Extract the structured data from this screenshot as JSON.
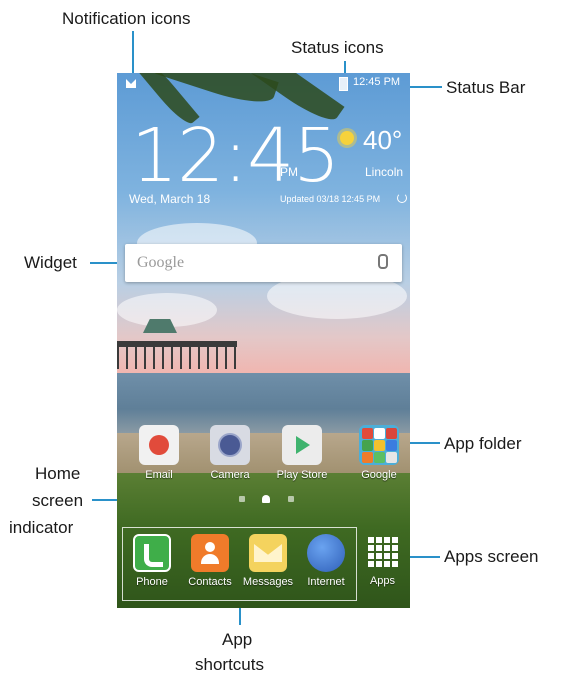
{
  "callouts": {
    "notification_icons": "Notification icons",
    "status_icons": "Status icons",
    "status_bar": "Status Bar",
    "widget": "Widget",
    "app_folder": "App folder",
    "home_indicator": [
      "Home",
      "screen",
      "indicator"
    ],
    "apps_screen": "Apps screen",
    "app_shortcuts": [
      "App",
      "shortcuts"
    ]
  },
  "status_bar": {
    "time": "12:45 PM"
  },
  "widget": {
    "time": "12:45",
    "ampm": "PM",
    "date": "Wed, March 18",
    "temperature": "40°",
    "city": "Lincoln",
    "updated": "Updated 03/18 12:45 PM"
  },
  "search": {
    "placeholder": "Google"
  },
  "home_apps": [
    {
      "label": "Email",
      "icon": "email-icon"
    },
    {
      "label": "Camera",
      "icon": "camera-icon"
    },
    {
      "label": "Play Store",
      "icon": "play-store-icon"
    },
    {
      "label": "Google",
      "icon": "google-folder-icon"
    }
  ],
  "dock_apps": [
    {
      "label": "Phone",
      "icon": "phone-icon"
    },
    {
      "label": "Contacts",
      "icon": "contacts-icon"
    },
    {
      "label": "Messages",
      "icon": "messages-icon"
    },
    {
      "label": "Internet",
      "icon": "internet-icon"
    }
  ],
  "apps_button": {
    "label": "Apps",
    "icon": "apps-grid-icon"
  },
  "colors": {
    "callout_line": "#2a91c9"
  }
}
